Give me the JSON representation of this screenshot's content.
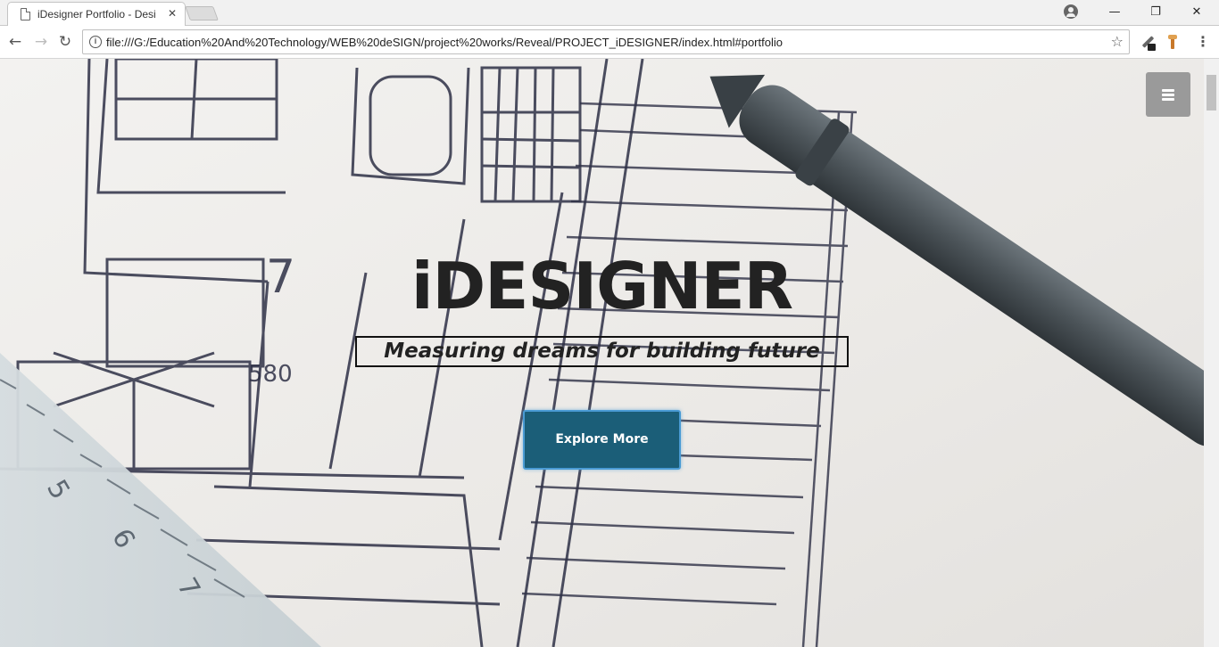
{
  "browser": {
    "tab_title": "iDesigner Portfolio - Desi",
    "tab_close": "✕",
    "url": "file:///G:/Education%20And%20Technology/WEB%20deSIGN/project%20works/Reveal/PROJECT_iDESIGNER/index.html#portfolio",
    "nav": {
      "back": "←",
      "forward": "→",
      "reload": "↻"
    },
    "info_icon": "i",
    "star_icon": "☆",
    "window": {
      "minimize": "—",
      "maximize": "❐",
      "close": "✕"
    },
    "menu": "⋮"
  },
  "hero": {
    "title": "iDESIGNER",
    "tagline": "Measuring dreams for building future",
    "cta_label": "Explore More"
  },
  "colors": {
    "cta_background": "#1b5e78",
    "cta_border": "#4a9bd4",
    "hamburger_background": "#9a9a9a"
  }
}
